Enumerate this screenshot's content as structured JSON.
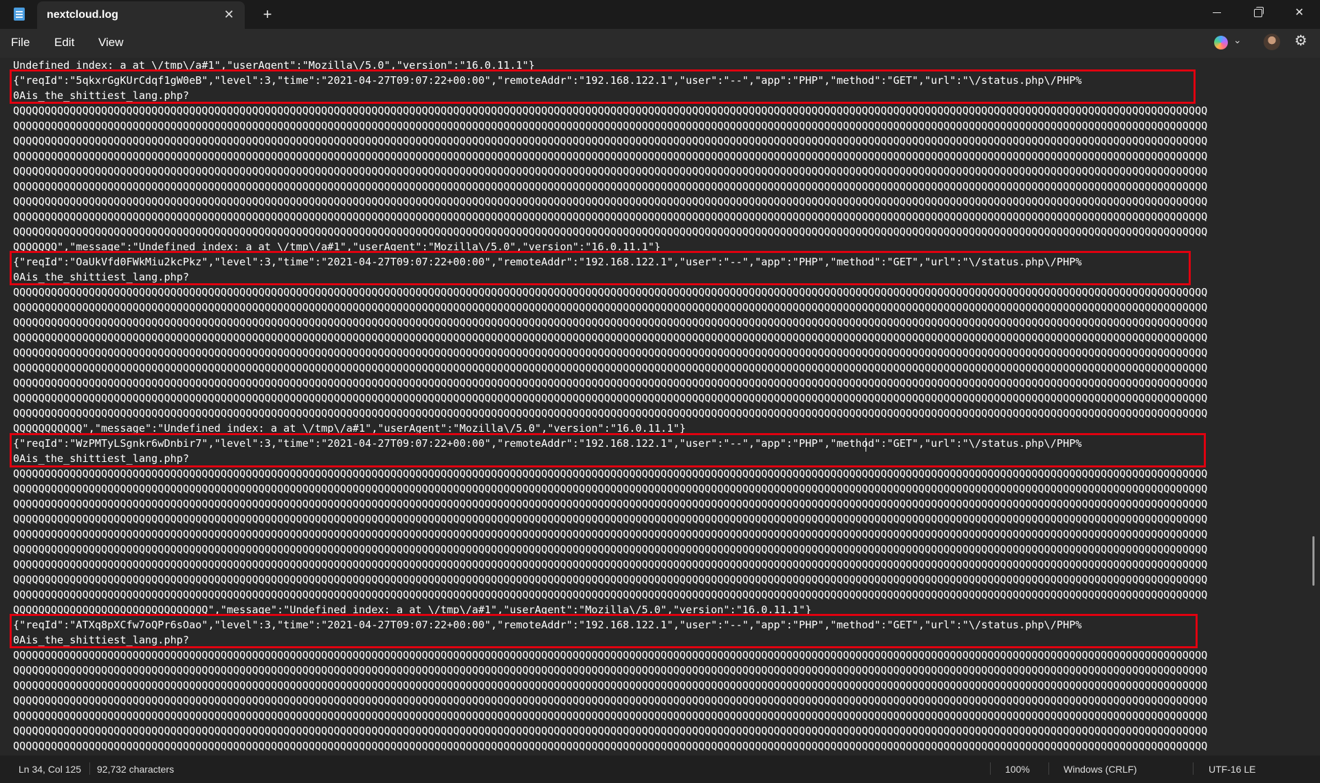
{
  "window": {
    "tab_title": "nextcloud.log",
    "minimize_label": "",
    "maximize_label": "",
    "close_label": "✕"
  },
  "menu": {
    "file": "File",
    "edit": "Edit",
    "view": "View"
  },
  "icons": {
    "app": "notepad-icon",
    "tab_close": "close-icon",
    "new_tab": "plus-icon",
    "copilot": "copilot-icon",
    "chevron": "chevron-down-icon",
    "avatar": "avatar",
    "settings": "gear-icon"
  },
  "editor": {
    "lines": [
      "Undefined index: a at \\/tmp\\/a#1\",\"userAgent\":\"Mozilla\\/5.0\",\"version\":\"16.0.11.1\"}",
      "{\"reqId\":\"5qkxrGgKUrCdqf1gW0eB\",\"level\":3,\"time\":\"2021-04-27T09:07:22+00:00\",\"remoteAddr\":\"192.168.122.1\",\"user\":\"--\",\"app\":\"PHP\",\"method\":\"GET\",\"url\":\"\\/status.php\\/PHP%",
      "0Ais_the_shittiest_lang.php?",
      "QQQQQQQQQQQQQQQQQQQQQQQQQQQQQQQQQQQQQQQQQQQQQQQQQQQQQQQQQQQQQQQQQQQQQQQQQQQQQQQQQQQQQQQQQQQQQQQQQQQQQQQQQQQQQQQQQQQQQQQQQQQQQQQQQQQQQQQQQQQQQQQQQQQQQQQQQQQQQQQQQQQQQQQQQQQQQQQQQQQQQQQQQQQQQQ",
      "QQQQQQQQQQQQQQQQQQQQQQQQQQQQQQQQQQQQQQQQQQQQQQQQQQQQQQQQQQQQQQQQQQQQQQQQQQQQQQQQQQQQQQQQQQQQQQQQQQQQQQQQQQQQQQQQQQQQQQQQQQQQQQQQQQQQQQQQQQQQQQQQQQQQQQQQQQQQQQQQQQQQQQQQQQQQQQQQQQQQQQQQQQQQQQ",
      "QQQQQQQQQQQQQQQQQQQQQQQQQQQQQQQQQQQQQQQQQQQQQQQQQQQQQQQQQQQQQQQQQQQQQQQQQQQQQQQQQQQQQQQQQQQQQQQQQQQQQQQQQQQQQQQQQQQQQQQQQQQQQQQQQQQQQQQQQQQQQQQQQQQQQQQQQQQQQQQQQQQQQQQQQQQQQQQQQQQQQQQQQQQQQQ",
      "QQQQQQQQQQQQQQQQQQQQQQQQQQQQQQQQQQQQQQQQQQQQQQQQQQQQQQQQQQQQQQQQQQQQQQQQQQQQQQQQQQQQQQQQQQQQQQQQQQQQQQQQQQQQQQQQQQQQQQQQQQQQQQQQQQQQQQQQQQQQQQQQQQQQQQQQQQQQQQQQQQQQQQQQQQQQQQQQQQQQQQQQQQQQQQ",
      "QQQQQQQQQQQQQQQQQQQQQQQQQQQQQQQQQQQQQQQQQQQQQQQQQQQQQQQQQQQQQQQQQQQQQQQQQQQQQQQQQQQQQQQQQQQQQQQQQQQQQQQQQQQQQQQQQQQQQQQQQQQQQQQQQQQQQQQQQQQQQQQQQQQQQQQQQQQQQQQQQQQQQQQQQQQQQQQQQQQQQQQQQQQQQQ",
      "QQQQQQQQQQQQQQQQQQQQQQQQQQQQQQQQQQQQQQQQQQQQQQQQQQQQQQQQQQQQQQQQQQQQQQQQQQQQQQQQQQQQQQQQQQQQQQQQQQQQQQQQQQQQQQQQQQQQQQQQQQQQQQQQQQQQQQQQQQQQQQQQQQQQQQQQQQQQQQQQQQQQQQQQQQQQQQQQQQQQQQQQQQQQQQ",
      "QQQQQQQQQQQQQQQQQQQQQQQQQQQQQQQQQQQQQQQQQQQQQQQQQQQQQQQQQQQQQQQQQQQQQQQQQQQQQQQQQQQQQQQQQQQQQQQQQQQQQQQQQQQQQQQQQQQQQQQQQQQQQQQQQQQQQQQQQQQQQQQQQQQQQQQQQQQQQQQQQQQQQQQQQQQQQQQQQQQQQQQQQQQQQQ",
      "QQQQQQQQQQQQQQQQQQQQQQQQQQQQQQQQQQQQQQQQQQQQQQQQQQQQQQQQQQQQQQQQQQQQQQQQQQQQQQQQQQQQQQQQQQQQQQQQQQQQQQQQQQQQQQQQQQQQQQQQQQQQQQQQQQQQQQQQQQQQQQQQQQQQQQQQQQQQQQQQQQQQQQQQQQQQQQQQQQQQQQQQQQQQQQ",
      "QQQQQQQQQQQQQQQQQQQQQQQQQQQQQQQQQQQQQQQQQQQQQQQQQQQQQQQQQQQQQQQQQQQQQQQQQQQQQQQQQQQQQQQQQQQQQQQQQQQQQQQQQQQQQQQQQQQQQQQQQQQQQQQQQQQQQQQQQQQQQQQQQQQQQQQQQQQQQQQQQQQQQQQQQQQQQQQQQQQQQQQQQQQQQQ",
      "QQQQQQQ\",\"message\":\"Undefined index: a at \\/tmp\\/a#1\",\"userAgent\":\"Mozilla\\/5.0\",\"version\":\"16.0.11.1\"}",
      "{\"reqId\":\"OaUkVfd0FWkMiu2kcPkz\",\"level\":3,\"time\":\"2021-04-27T09:07:22+00:00\",\"remoteAddr\":\"192.168.122.1\",\"user\":\"--\",\"app\":\"PHP\",\"method\":\"GET\",\"url\":\"\\/status.php\\/PHP%",
      "0Ais_the_shittiest_lang.php?",
      "QQQQQQQQQQQQQQQQQQQQQQQQQQQQQQQQQQQQQQQQQQQQQQQQQQQQQQQQQQQQQQQQQQQQQQQQQQQQQQQQQQQQQQQQQQQQQQQQQQQQQQQQQQQQQQQQQQQQQQQQQQQQQQQQQQQQQQQQQQQQQQQQQQQQQQQQQQQQQQQQQQQQQQQQQQQQQQQQQQQQQQQQQQQQQQ",
      "QQQQQQQQQQQQQQQQQQQQQQQQQQQQQQQQQQQQQQQQQQQQQQQQQQQQQQQQQQQQQQQQQQQQQQQQQQQQQQQQQQQQQQQQQQQQQQQQQQQQQQQQQQQQQQQQQQQQQQQQQQQQQQQQQQQQQQQQQQQQQQQQQQQQQQQQQQQQQQQQQQQQQQQQQQQQQQQQQQQQQQQQQQQQQQ",
      "QQQQQQQQQQQQQQQQQQQQQQQQQQQQQQQQQQQQQQQQQQQQQQQQQQQQQQQQQQQQQQQQQQQQQQQQQQQQQQQQQQQQQQQQQQQQQQQQQQQQQQQQQQQQQQQQQQQQQQQQQQQQQQQQQQQQQQQQQQQQQQQQQQQQQQQQQQQQQQQQQQQQQQQQQQQQQQQQQQQQQQQQQQQQQQ",
      "QQQQQQQQQQQQQQQQQQQQQQQQQQQQQQQQQQQQQQQQQQQQQQQQQQQQQQQQQQQQQQQQQQQQQQQQQQQQQQQQQQQQQQQQQQQQQQQQQQQQQQQQQQQQQQQQQQQQQQQQQQQQQQQQQQQQQQQQQQQQQQQQQQQQQQQQQQQQQQQQQQQQQQQQQQQQQQQQQQQQQQQQQQQQQQ",
      "QQQQQQQQQQQQQQQQQQQQQQQQQQQQQQQQQQQQQQQQQQQQQQQQQQQQQQQQQQQQQQQQQQQQQQQQQQQQQQQQQQQQQQQQQQQQQQQQQQQQQQQQQQQQQQQQQQQQQQQQQQQQQQQQQQQQQQQQQQQQQQQQQQQQQQQQQQQQQQQQQQQQQQQQQQQQQQQQQQQQQQQQQQQQQQ",
      "QQQQQQQQQQQQQQQQQQQQQQQQQQQQQQQQQQQQQQQQQQQQQQQQQQQQQQQQQQQQQQQQQQQQQQQQQQQQQQQQQQQQQQQQQQQQQQQQQQQQQQQQQQQQQQQQQQQQQQQQQQQQQQQQQQQQQQQQQQQQQQQQQQQQQQQQQQQQQQQQQQQQQQQQQQQQQQQQQQQQQQQQQQQQQQ",
      "QQQQQQQQQQQQQQQQQQQQQQQQQQQQQQQQQQQQQQQQQQQQQQQQQQQQQQQQQQQQQQQQQQQQQQQQQQQQQQQQQQQQQQQQQQQQQQQQQQQQQQQQQQQQQQQQQQQQQQQQQQQQQQQQQQQQQQQQQQQQQQQQQQQQQQQQQQQQQQQQQQQQQQQQQQQQQQQQQQQQQQQQQQQQQQ",
      "QQQQQQQQQQQQQQQQQQQQQQQQQQQQQQQQQQQQQQQQQQQQQQQQQQQQQQQQQQQQQQQQQQQQQQQQQQQQQQQQQQQQQQQQQQQQQQQQQQQQQQQQQQQQQQQQQQQQQQQQQQQQQQQQQQQQQQQQQQQQQQQQQQQQQQQQQQQQQQQQQQQQQQQQQQQQQQQQQQQQQQQQQQQQQQ",
      "QQQQQQQQQQQQQQQQQQQQQQQQQQQQQQQQQQQQQQQQQQQQQQQQQQQQQQQQQQQQQQQQQQQQQQQQQQQQQQQQQQQQQQQQQQQQQQQQQQQQQQQQQQQQQQQQQQQQQQQQQQQQQQQQQQQQQQQQQQQQQQQQQQQQQQQQQQQQQQQQQQQQQQQQQQQQQQQQQQQQQQQQQQQQQQ",
      "QQQQQQQQQQQ\",\"message\":\"Undefined index: a at \\/tmp\\/a#1\",\"userAgent\":\"Mozilla\\/5.0\",\"version\":\"16.0.11.1\"}",
      "{\"reqId\":\"WzPMTyLSgnkr6wDnbir7\",\"level\":3,\"time\":\"2021-04-27T09:07:22+00:00\",\"remoteAddr\":\"192.168.122.1\",\"user\":\"--\",\"app\":\"PHP\",\"method\":\"GET\",\"url\":\"\\/status.php\\/PHP%",
      "0Ais_the_shittiest_lang.php?",
      "QQQQQQQQQQQQQQQQQQQQQQQQQQQQQQQQQQQQQQQQQQQQQQQQQQQQQQQQQQQQQQQQQQQQQQQQQQQQQQQQQQQQQQQQQQQQQQQQQQQQQQQQQQQQQQQQQQQQQQQQQQQQQQQQQQQQQQQQQQQQQQQQQQQQQQQQQQQQQQQQQQQQQQQQQQQQQQQQQQQQQQQQQQQQQQ",
      "QQQQQQQQQQQQQQQQQQQQQQQQQQQQQQQQQQQQQQQQQQQQQQQQQQQQQQQQQQQQQQQQQQQQQQQQQQQQQQQQQQQQQQQQQQQQQQQQQQQQQQQQQQQQQQQQQQQQQQQQQQQQQQQQQQQQQQQQQQQQQQQQQQQQQQQQQQQQQQQQQQQQQQQQQQQQQQQQQQQQQQQQQQQQQQ",
      "QQQQQQQQQQQQQQQQQQQQQQQQQQQQQQQQQQQQQQQQQQQQQQQQQQQQQQQQQQQQQQQQQQQQQQQQQQQQQQQQQQQQQQQQQQQQQQQQQQQQQQQQQQQQQQQQQQQQQQQQQQQQQQQQQQQQQQQQQQQQQQQQQQQQQQQQQQQQQQQQQQQQQQQQQQQQQQQQQQQQQQQQQQQQQQ",
      "QQQQQQQQQQQQQQQQQQQQQQQQQQQQQQQQQQQQQQQQQQQQQQQQQQQQQQQQQQQQQQQQQQQQQQQQQQQQQQQQQQQQQQQQQQQQQQQQQQQQQQQQQQQQQQQQQQQQQQQQQQQQQQQQQQQQQQQQQQQQQQQQQQQQQQQQQQQQQQQQQQQQQQQQQQQQQQQQQQQQQQQQQQQQQQ",
      "QQQQQQQQQQQQQQQQQQQQQQQQQQQQQQQQQQQQQQQQQQQQQQQQQQQQQQQQQQQQQQQQQQQQQQQQQQQQQQQQQQQQQQQQQQQQQQQQQQQQQQQQQQQQQQQQQQQQQQQQQQQQQQQQQQQQQQQQQQQQQQQQQQQQQQQQQQQQQQQQQQQQQQQQQQQQQQQQQQQQQQQQQQQQQQ",
      "QQQQQQQQQQQQQQQQQQQQQQQQQQQQQQQQQQQQQQQQQQQQQQQQQQQQQQQQQQQQQQQQQQQQQQQQQQQQQQQQQQQQQQQQQQQQQQQQQQQQQQQQQQQQQQQQQQQQQQQQQQQQQQQQQQQQQQQQQQQQQQQQQQQQQQQQQQQQQQQQQQQQQQQQQQQQQQQQQQQQQQQQQQQQQQ",
      "QQQQQQQQQQQQQQQQQQQQQQQQQQQQQQQQQQQQQQQQQQQQQQQQQQQQQQQQQQQQQQQQQQQQQQQQQQQQQQQQQQQQQQQQQQQQQQQQQQQQQQQQQQQQQQQQQQQQQQQQQQQQQQQQQQQQQQQQQQQQQQQQQQQQQQQQQQQQQQQQQQQQQQQQQQQQQQQQQQQQQQQQQQQQQQ",
      "QQQQQQQQQQQQQQQQQQQQQQQQQQQQQQQQQQQQQQQQQQQQQQQQQQQQQQQQQQQQQQQQQQQQQQQQQQQQQQQQQQQQQQQQQQQQQQQQQQQQQQQQQQQQQQQQQQQQQQQQQQQQQQQQQQQQQQQQQQQQQQQQQQQQQQQQQQQQQQQQQQQQQQQQQQQQQQQQQQQQQQQQQQQQQQ",
      "QQQQQQQQQQQQQQQQQQQQQQQQQQQQQQQQQQQQQQQQQQQQQQQQQQQQQQQQQQQQQQQQQQQQQQQQQQQQQQQQQQQQQQQQQQQQQQQQQQQQQQQQQQQQQQQQQQQQQQQQQQQQQQQQQQQQQQQQQQQQQQQQQQQQQQQQQQQQQQQQQQQQQQQQQQQQQQQQQQQQQQQQQQQQQQ",
      "QQQQQQQQQQQQQQQQQQQQQQQQQQQQQQQ\",\"message\":\"Undefined index: a at \\/tmp\\/a#1\",\"userAgent\":\"Mozilla\\/5.0\",\"version\":\"16.0.11.1\"}",
      "{\"reqId\":\"ATXq8pXCfw7oQPr6sOao\",\"level\":3,\"time\":\"2021-04-27T09:07:22+00:00\",\"remoteAddr\":\"192.168.122.1\",\"user\":\"--\",\"app\":\"PHP\",\"method\":\"GET\",\"url\":\"\\/status.php\\/PHP%",
      "0Ais_the_shittiest_lang.php?",
      "QQQQQQQQQQQQQQQQQQQQQQQQQQQQQQQQQQQQQQQQQQQQQQQQQQQQQQQQQQQQQQQQQQQQQQQQQQQQQQQQQQQQQQQQQQQQQQQQQQQQQQQQQQQQQQQQQQQQQQQQQQQQQQQQQQQQQQQQQQQQQQQQQQQQQQQQQQQQQQQQQQQQQQQQQQQQQQQQQQQQQQQQQQQQQQ",
      "QQQQQQQQQQQQQQQQQQQQQQQQQQQQQQQQQQQQQQQQQQQQQQQQQQQQQQQQQQQQQQQQQQQQQQQQQQQQQQQQQQQQQQQQQQQQQQQQQQQQQQQQQQQQQQQQQQQQQQQQQQQQQQQQQQQQQQQQQQQQQQQQQQQQQQQQQQQQQQQQQQQQQQQQQQQQQQQQQQQQQQQQQQQQQQ",
      "QQQQQQQQQQQQQQQQQQQQQQQQQQQQQQQQQQQQQQQQQQQQQQQQQQQQQQQQQQQQQQQQQQQQQQQQQQQQQQQQQQQQQQQQQQQQQQQQQQQQQQQQQQQQQQQQQQQQQQQQQQQQQQQQQQQQQQQQQQQQQQQQQQQQQQQQQQQQQQQQQQQQQQQQQQQQQQQQQQQQQQQQQQQQQQ",
      "QQQQQQQQQQQQQQQQQQQQQQQQQQQQQQQQQQQQQQQQQQQQQQQQQQQQQQQQQQQQQQQQQQQQQQQQQQQQQQQQQQQQQQQQQQQQQQQQQQQQQQQQQQQQQQQQQQQQQQQQQQQQQQQQQQQQQQQQQQQQQQQQQQQQQQQQQQQQQQQQQQQQQQQQQQQQQQQQQQQQQQQQQQQQQQ",
      "QQQQQQQQQQQQQQQQQQQQQQQQQQQQQQQQQQQQQQQQQQQQQQQQQQQQQQQQQQQQQQQQQQQQQQQQQQQQQQQQQQQQQQQQQQQQQQQQQQQQQQQQQQQQQQQQQQQQQQQQQQQQQQQQQQQQQQQQQQQQQQQQQQQQQQQQQQQQQQQQQQQQQQQQQQQQQQQQQQQQQQQQQQQQQQ",
      "QQQQQQQQQQQQQQQQQQQQQQQQQQQQQQQQQQQQQQQQQQQQQQQQQQQQQQQQQQQQQQQQQQQQQQQQQQQQQQQQQQQQQQQQQQQQQQQQQQQQQQQQQQQQQQQQQQQQQQQQQQQQQQQQQQQQQQQQQQQQQQQQQQQQQQQQQQQQQQQQQQQQQQQQQQQQQQQQQQQQQQQQQQQQQQ",
      "QQQQQQQQQQQQQQQQQQQQQQQQQQQQQQQQQQQQQQQQQQQQQQQQQQQQQQQQQQQQQQQQQQQQQQQQQQQQQQQQQQQQQQQQQQQQQQQQQQQQQQQQQQQQQQQQQQQQQQQQQQQQQQQQQQQQQQQQQQQQQQQQQQQQQQQQQQQQQQQQQQQQQQQQQQQQQQQQQQQQQQQQQQQQQQ",
      "QQQQQQQQQQQQQQQQQQQQQQQQQQQQQQQQQQQQQQQQQQQQQQQQQQQQQQQQQQQQQQQQQQQQQQQQQQQQQQQQQQQQQQQQQQQQQQQQQQQQQQQQQQQQQQQQQQQQQQQQQQQQQQQQQQQQQQQQQQQQQQQQQQQQQQQQQQQQQQQQQQQQQQQQQQQQQQQQQQQQQQQQQQQQQQ"
    ]
  },
  "status": {
    "position": "Ln 34, Col 125",
    "characters": "92,732 characters",
    "zoom": "100%",
    "line_ending": "Windows (CRLF)",
    "encoding": "UTF-16 LE"
  },
  "colors": {
    "highlight": "#e1000f",
    "editor_bg": "#272727",
    "chrome_bg": "#2b2b2b"
  }
}
